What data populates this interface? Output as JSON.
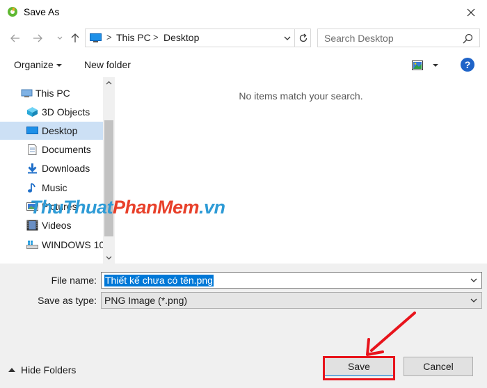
{
  "window": {
    "title": "Save As",
    "icon": "app-logo-icon",
    "close_icon": "close-icon"
  },
  "nav": {
    "back_icon": "arrow-left-icon",
    "forward_icon": "arrow-right-icon",
    "recent_icon": "chevron-down-icon",
    "up_icon": "arrow-up-icon",
    "breadcrumb": [
      "This PC",
      "Desktop"
    ],
    "search_placeholder": "Search Desktop"
  },
  "toolbar": {
    "organize_label": "Organize",
    "new_folder_label": "New folder",
    "help_label": "?"
  },
  "sidebar": {
    "items": [
      {
        "label": "This PC",
        "icon": "computer-icon",
        "selected": false
      },
      {
        "label": "3D Objects",
        "icon": "cube-icon",
        "selected": false
      },
      {
        "label": "Desktop",
        "icon": "desktop-icon",
        "selected": true
      },
      {
        "label": "Documents",
        "icon": "document-icon",
        "selected": false
      },
      {
        "label": "Downloads",
        "icon": "download-icon",
        "selected": false
      },
      {
        "label": "Music",
        "icon": "music-icon",
        "selected": false
      },
      {
        "label": "Pictures",
        "icon": "picture-icon",
        "selected": false
      },
      {
        "label": "Videos",
        "icon": "video-icon",
        "selected": false
      },
      {
        "label": "WINDOWS 10",
        "icon": "drive-icon",
        "selected": false
      }
    ]
  },
  "content": {
    "empty_message": "No items match your search."
  },
  "form": {
    "file_name_label": "File name:",
    "file_name_value": "Thiết kế chưa có tên.png",
    "save_type_label": "Save as type:",
    "save_type_value": "PNG Image (*.png)"
  },
  "footer": {
    "hide_folders_label": "Hide Folders",
    "save_label": "Save",
    "cancel_label": "Cancel"
  },
  "watermark": {
    "part_a": "ThuThuat",
    "part_b": "PhanMem",
    "part_c": ".vn"
  },
  "colors": {
    "selection": "#cce0f5",
    "accent": "#0078d7",
    "annotation_red": "#e8141c"
  }
}
